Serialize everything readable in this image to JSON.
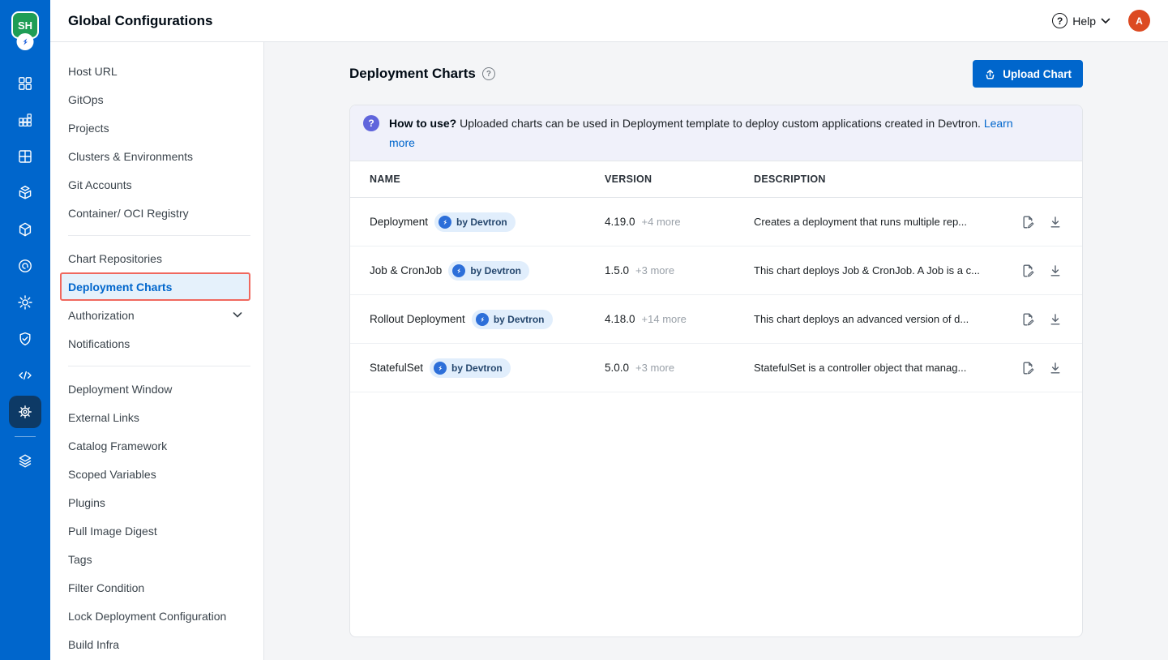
{
  "colors": {
    "rail_bg": "#0066CC",
    "rail_selected_bg": "#0D3A66",
    "accent_blue": "#0066CC",
    "selected_nav_bg": "#E5F1FB",
    "selected_nav_highlight_border": "#F0685E",
    "banner_bg": "#F0F1FA",
    "banner_icon_purple": "#6065DC",
    "avatar_orange": "#DC4A22",
    "org_logo_green": "#1E9D55",
    "badge_bg": "#E1EEFC",
    "main_bg": "#F4F5F7"
  },
  "rail": {
    "org_logo_text": "SH",
    "icons": [
      "devtron-logo",
      "apps-grid",
      "jobs-blocks",
      "window-grid",
      "package",
      "cube",
      "spiral",
      "sun-gear",
      "shield-check",
      "code",
      "gear (selected)",
      "layers"
    ]
  },
  "header": {
    "title": "Global Configurations",
    "help_label": "Help",
    "help_icon": "?",
    "avatar_initial": "A"
  },
  "sidebar": {
    "group1": [
      {
        "label": "Host URL"
      },
      {
        "label": "GitOps"
      },
      {
        "label": "Projects"
      },
      {
        "label": "Clusters & Environments"
      },
      {
        "label": "Git Accounts"
      },
      {
        "label": "Container/ OCI Registry"
      }
    ],
    "group2": [
      {
        "label": "Chart Repositories"
      },
      {
        "label": "Deployment Charts",
        "selected": true
      },
      {
        "label": "Authorization",
        "chevron": true
      },
      {
        "label": "Notifications"
      }
    ],
    "group3": [
      {
        "label": "Deployment Window"
      },
      {
        "label": "External Links"
      },
      {
        "label": "Catalog Framework"
      },
      {
        "label": "Scoped Variables"
      },
      {
        "label": "Plugins"
      },
      {
        "label": "Pull Image Digest"
      },
      {
        "label": "Tags"
      },
      {
        "label": "Filter Condition"
      },
      {
        "label": "Lock Deployment Configuration"
      },
      {
        "label": "Build Infra"
      }
    ]
  },
  "main": {
    "title": "Deployment Charts",
    "title_help_icon": "?",
    "upload_button": "Upload Chart",
    "banner": {
      "icon": "?",
      "title_bold": "How to use?",
      "body": "Uploaded charts can be used in Deployment template to deploy custom applications created in Devtron.",
      "link": "Learn more"
    },
    "table": {
      "columns": [
        "NAME",
        "VERSION",
        "DESCRIPTION"
      ],
      "rows": [
        {
          "name": "Deployment",
          "badge": "by Devtron",
          "version": "4.19.0",
          "more": "+4 more",
          "description": "Creates a deployment that runs multiple rep..."
        },
        {
          "name": "Job & CronJob",
          "badge": "by Devtron",
          "version": "1.5.0",
          "more": "+3 more",
          "description": "This chart deploys Job & CronJob. A Job is a c..."
        },
        {
          "name": "Rollout Deployment",
          "badge": "by Devtron",
          "version": "4.18.0",
          "more": "+14 more",
          "description": "This chart deploys an advanced version of d..."
        },
        {
          "name": "StatefulSet",
          "badge": "by Devtron",
          "version": "5.0.0",
          "more": "+3 more",
          "description": "StatefulSet is a controller object that manag..."
        }
      ]
    }
  }
}
